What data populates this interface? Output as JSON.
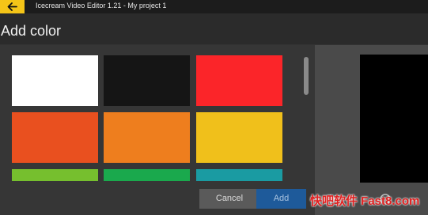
{
  "window": {
    "title": "Icecream Video Editor 1.21 - My project 1",
    "accent_color": "#f5c518"
  },
  "dialog": {
    "heading": "Add color",
    "swatches": [
      {
        "color": "#ffffff"
      },
      {
        "color": "#151515"
      },
      {
        "color": "#fb2529"
      },
      {
        "color": "#e9501f"
      },
      {
        "color": "#ee7e1e"
      },
      {
        "color": "#f0c01b"
      },
      {
        "color": "#76bf2e"
      },
      {
        "color": "#1aa94d"
      },
      {
        "color": "#1a9ba2"
      }
    ],
    "cancel_label": "Cancel",
    "add_label": "Add"
  },
  "preview": {
    "icons": [
      "play-icon",
      "circle-icon"
    ]
  },
  "watermark": {
    "text": "快吧软件 Fast8.com"
  }
}
